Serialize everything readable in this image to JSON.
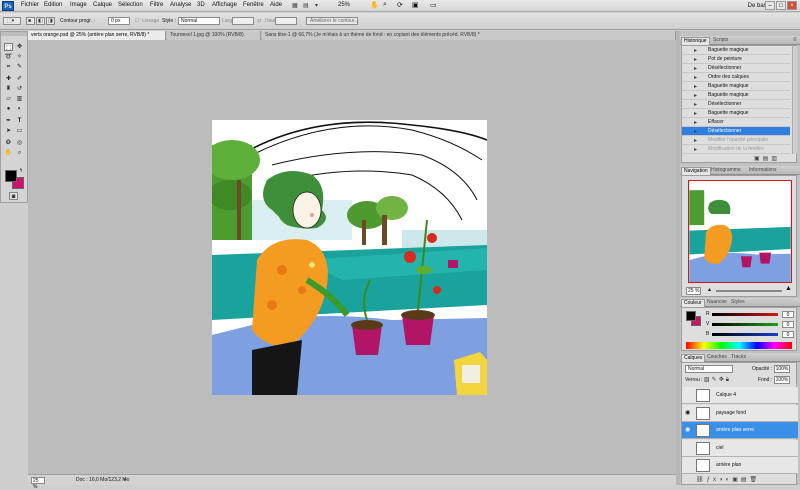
{
  "menubar": {
    "logo": "Ps",
    "items": [
      "Fichier",
      "Edition",
      "Image",
      "Calque",
      "Sélection",
      "Filtre",
      "Analyse",
      "3D",
      "Affichage",
      "Fenêtre",
      "Aide"
    ],
    "zoom": "25%",
    "workspace": "De base",
    "win_min": "–",
    "win_max": "□",
    "win_close": "×"
  },
  "options": {
    "contour_label": "Contour progr. :",
    "contour_value": "0 px",
    "lissage_label": "Lissage",
    "style_label": "Style :",
    "style_value": "Normal",
    "largeur_label": "Larg.:",
    "hauteur_label": "Haut.:",
    "refine_label": "Améliorer le contour..."
  },
  "tabs": [
    "verts orange.psd @ 25% (arrière plan serre, RVB/8) *",
    "Tournesol 1.jpg @ 100% (RVB/8)",
    "Sans titre-1 @ 66,7% (Je m'étais à un thème de fond : en copiant des éléments précéd. RVB/8) *"
  ],
  "status": {
    "zoom": "25 %",
    "doc": "Doc : 16,0 Mo/123,2 Mo"
  },
  "history": {
    "tabs": [
      "Historique",
      "Scripts"
    ],
    "items": [
      {
        "label": "Baguette magique",
        "state": "normal"
      },
      {
        "label": "Pot de peinture",
        "state": "normal"
      },
      {
        "label": "Désélectionner",
        "state": "normal"
      },
      {
        "label": "Ordre des calques",
        "state": "normal"
      },
      {
        "label": "Baguette magique",
        "state": "normal"
      },
      {
        "label": "Baguette magique",
        "state": "normal"
      },
      {
        "label": "Désélectionner",
        "state": "normal"
      },
      {
        "label": "Baguette magique",
        "state": "normal"
      },
      {
        "label": "Effacer",
        "state": "normal"
      },
      {
        "label": "Désélectionner",
        "state": "selected"
      },
      {
        "label": "Modifier l'opacité principale",
        "state": "dim"
      },
      {
        "label": "Modification de la fenêtre",
        "state": "dim"
      }
    ]
  },
  "navigation": {
    "tabs": [
      "Navigation",
      "Histogramme",
      "Informations"
    ],
    "zoom": "25 %"
  },
  "color": {
    "tabs": [
      "Couleur",
      "Nuancier",
      "Styles"
    ],
    "channels": [
      {
        "label": "R",
        "value": "0",
        "color": "#d21b1b"
      },
      {
        "label": "V",
        "value": "0",
        "color": "#1ea21e"
      },
      {
        "label": "B",
        "value": "0",
        "color": "#1b3fd2"
      }
    ]
  },
  "layers": {
    "tabs": [
      "Calques",
      "Couches",
      "Tracés"
    ],
    "blend_mode": "Normal",
    "opacity_label": "Opacité :",
    "opacity_value": "100%",
    "lock_label": "Verrou :",
    "fill_label": "Fond :",
    "fill_value": "100%",
    "items": [
      {
        "label": "Calque 4",
        "visible": false,
        "selected": false
      },
      {
        "label": "paysage fond",
        "visible": true,
        "selected": false
      },
      {
        "label": "arrière plan serre",
        "visible": true,
        "selected": true
      },
      {
        "label": "ciel",
        "visible": false,
        "selected": false
      },
      {
        "label": "arrière plan",
        "visible": false,
        "selected": false
      }
    ]
  },
  "colors": {
    "accent": "#2f7fe0",
    "foreground": "#000000",
    "background": "#d0106a"
  }
}
